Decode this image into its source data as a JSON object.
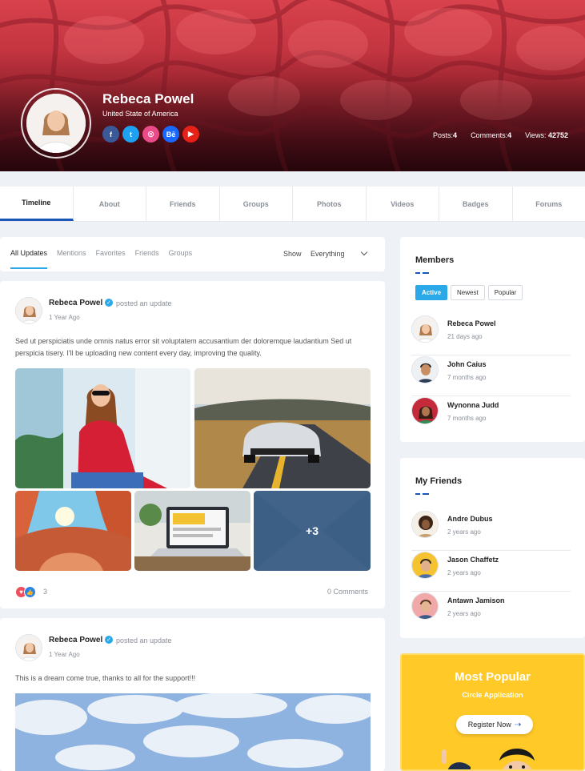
{
  "profile": {
    "name": "Rebeca Powel",
    "location": "United State of America",
    "socials": [
      {
        "label": "f",
        "icon": "facebook-icon",
        "color": "#3b5998"
      },
      {
        "label": "t",
        "icon": "twitter-icon",
        "color": "#1da1f2"
      },
      {
        "label": "◎",
        "icon": "dribbble-icon",
        "color": "#ea4c89"
      },
      {
        "label": "Bē",
        "icon": "behance-icon",
        "color": "#1769ff"
      },
      {
        "label": "▶",
        "icon": "youtube-icon",
        "color": "#e62117"
      }
    ],
    "stats": {
      "posts_label": "Posts:",
      "posts_value": "4",
      "comments_label": "Comments:",
      "comments_value": "4",
      "views_label": "Views:",
      "views_value": "42752"
    }
  },
  "tabs": [
    "Timeline",
    "About",
    "Friends",
    "Groups",
    "Photos",
    "Videos",
    "Badges",
    "Forums"
  ],
  "feed": {
    "filters": [
      "All Updates",
      "Mentions",
      "Favorites",
      "Friends",
      "Groups"
    ],
    "show_label": "Show",
    "show_value": "Everything"
  },
  "posts": [
    {
      "author": "Rebeca Powel",
      "action": "posted an update",
      "time": "1 Year Ago",
      "text": "Sed ut perspiciatis unde omnis natus error sit voluptatem accusantium der doloremque laudantium Sed ut perspicia tisery. I'll be uploading new content every day, improving the quality.",
      "more_photos": "+3",
      "reaction_count": "3",
      "comments": "0 Comments"
    },
    {
      "author": "Rebeca Powel",
      "action": "posted an update",
      "time": "1 Year Ago",
      "text": "This is a dream come true, thanks to all for the support!!!"
    }
  ],
  "members": {
    "title": "Members",
    "tabs": [
      "Active",
      "Newest",
      "Popular"
    ],
    "items": [
      {
        "name": "Rebeca Powel",
        "time": "21 days ago"
      },
      {
        "name": "John Caius",
        "time": "7 months ago"
      },
      {
        "name": "Wynonna Judd",
        "time": "7 months ago"
      }
    ]
  },
  "friends": {
    "title": "My Friends",
    "items": [
      {
        "name": "Andre Dubus",
        "time": "2 years ago"
      },
      {
        "name": "Jason Chaffetz",
        "time": "2 years ago"
      },
      {
        "name": "Antawn Jamison",
        "time": "2 years ago"
      }
    ]
  },
  "promo": {
    "title": "Most Popular",
    "subtitle": "Circle Application",
    "button": "Register Now"
  },
  "colors": {
    "accent": "#2ba8e8",
    "brand_blue": "#1a56b8",
    "promo": "#ffc928"
  }
}
